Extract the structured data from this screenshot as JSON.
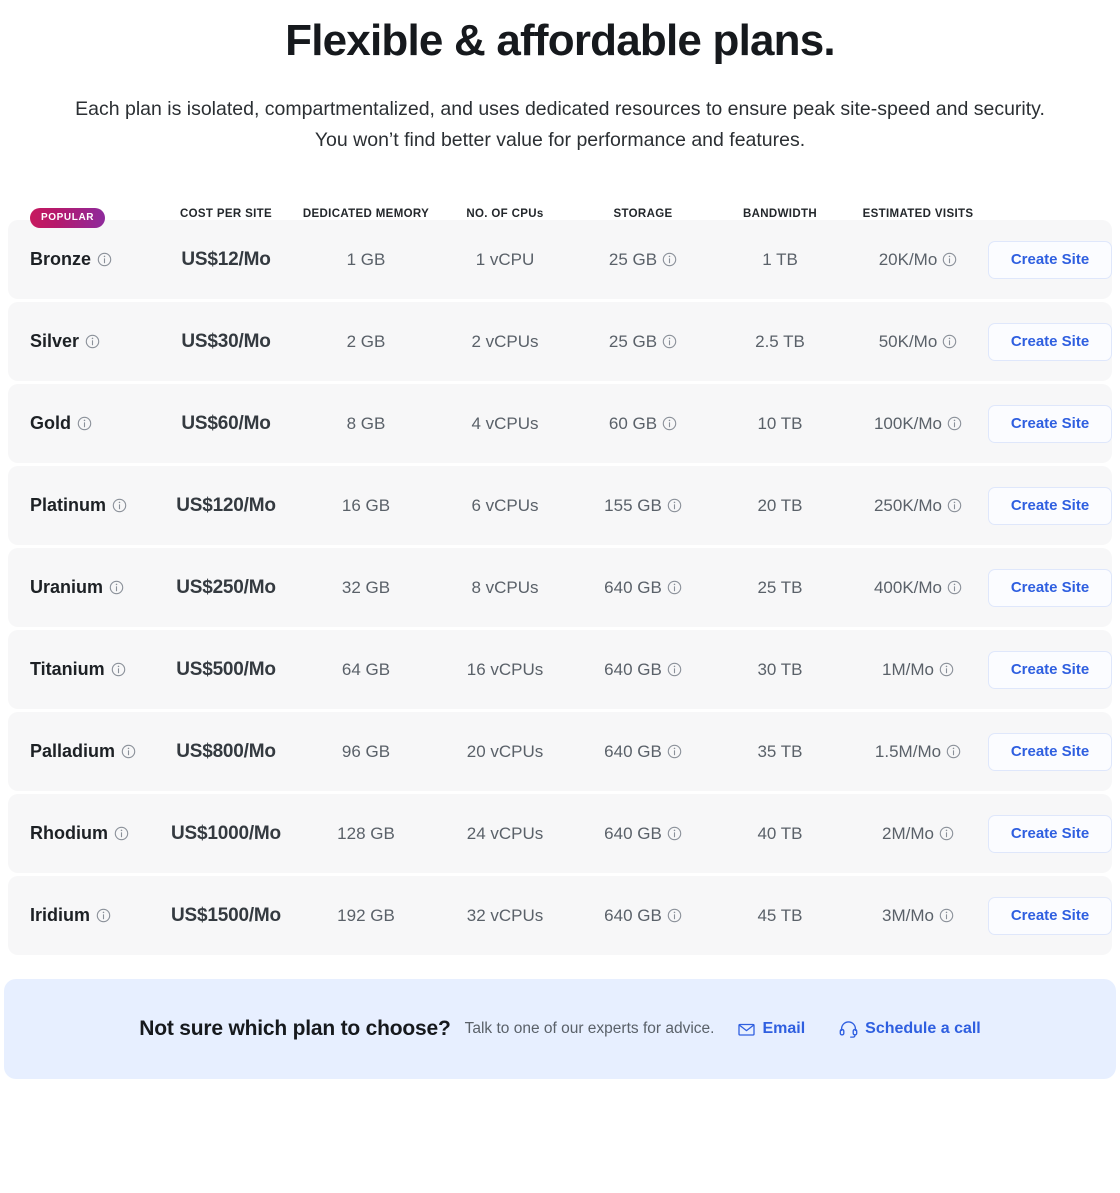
{
  "header": {
    "title": "Flexible & affordable plans.",
    "subtitle_line1": "Each plan is isolated, compartmentalized, and uses dedicated resources to ensure peak site-speed and security.",
    "subtitle_line2": "You won’t find better value for performance and features."
  },
  "table": {
    "columns": {
      "plan": "",
      "cost_per_site": "COST PER SITE",
      "dedicated_memory": "DEDICATED MEMORY",
      "no_of_cpus": "NO. OF CPUs",
      "storage": "STORAGE",
      "bandwidth": "BANDWIDTH",
      "estimated_visits": "ESTIMATED VISITS",
      "action": ""
    },
    "badge_popular": "POPULAR",
    "action_label": "Create Site",
    "rows": [
      {
        "plan": "Bronze",
        "popular": true,
        "cost_per_site": "US$12/Mo",
        "dedicated_memory": "1 GB",
        "no_of_cpus": "1 vCPU",
        "storage": "25 GB",
        "bandwidth": "1 TB",
        "estimated_visits": "20K/Mo",
        "action": "Create Site"
      },
      {
        "plan": "Silver",
        "popular": false,
        "cost_per_site": "US$30/Mo",
        "dedicated_memory": "2 GB",
        "no_of_cpus": "2 vCPUs",
        "storage": "25 GB",
        "bandwidth": "2.5 TB",
        "estimated_visits": "50K/Mo",
        "action": "Create Site"
      },
      {
        "plan": "Gold",
        "popular": false,
        "cost_per_site": "US$60/Mo",
        "dedicated_memory": "8 GB",
        "no_of_cpus": "4 vCPUs",
        "storage": "60 GB",
        "bandwidth": "10 TB",
        "estimated_visits": "100K/Mo",
        "action": "Create Site"
      },
      {
        "plan": "Platinum",
        "popular": false,
        "cost_per_site": "US$120/Mo",
        "dedicated_memory": "16 GB",
        "no_of_cpus": "6 vCPUs",
        "storage": "155 GB",
        "bandwidth": "20 TB",
        "estimated_visits": "250K/Mo",
        "action": "Create Site"
      },
      {
        "plan": "Uranium",
        "popular": false,
        "cost_per_site": "US$250/Mo",
        "dedicated_memory": "32 GB",
        "no_of_cpus": "8 vCPUs",
        "storage": "640 GB",
        "bandwidth": "25 TB",
        "estimated_visits": "400K/Mo",
        "action": "Create Site"
      },
      {
        "plan": "Titanium",
        "popular": false,
        "cost_per_site": "US$500/Mo",
        "dedicated_memory": "64 GB",
        "no_of_cpus": "16 vCPUs",
        "storage": "640 GB",
        "bandwidth": "30 TB",
        "estimated_visits": "1M/Mo",
        "action": "Create Site"
      },
      {
        "plan": "Palladium",
        "popular": false,
        "cost_per_site": "US$800/Mo",
        "dedicated_memory": "96 GB",
        "no_of_cpus": "20 vCPUs",
        "storage": "640 GB",
        "bandwidth": "35 TB",
        "estimated_visits": "1.5M/Mo",
        "action": "Create Site"
      },
      {
        "plan": "Rhodium",
        "popular": false,
        "cost_per_site": "US$1000/Mo",
        "dedicated_memory": "128 GB",
        "no_of_cpus": "24 vCPUs",
        "storage": "640 GB",
        "bandwidth": "40 TB",
        "estimated_visits": "2M/Mo",
        "action": "Create Site"
      },
      {
        "plan": "Iridium",
        "popular": false,
        "cost_per_site": "US$1500/Mo",
        "dedicated_memory": "192 GB",
        "no_of_cpus": "32 vCPUs",
        "storage": "640 GB",
        "bandwidth": "45 TB",
        "estimated_visits": "3M/Mo",
        "action": "Create Site"
      }
    ]
  },
  "cta": {
    "title": "Not sure which plan to choose?",
    "subtitle": "Talk to one of our experts for advice.",
    "email_label": "Email",
    "call_label": "Schedule a call",
    "email_icon": "envelope-icon",
    "call_icon": "headset-icon"
  },
  "colors": {
    "accent_blue": "#2f5fe0",
    "badge_gradient_start": "#c7195e",
    "badge_gradient_end": "#8e2a9c",
    "row_bg": "#f7f7f8",
    "cta_bg": "#e7efff"
  }
}
